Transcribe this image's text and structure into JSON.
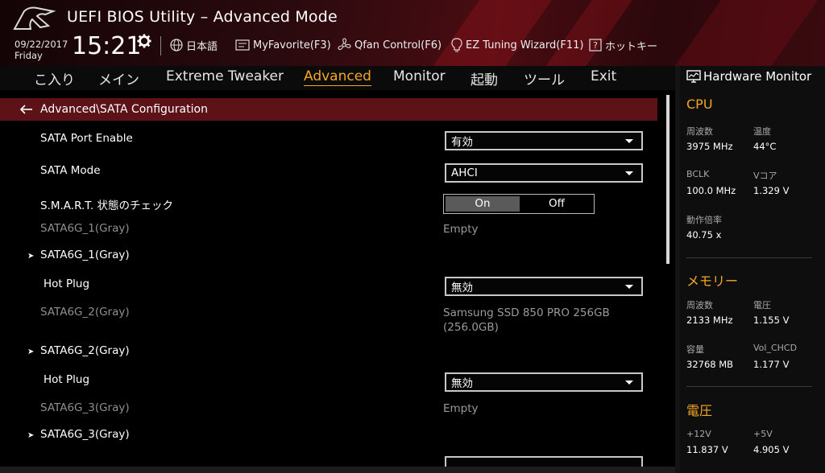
{
  "app": {
    "title": "UEFI BIOS Utility – Advanced Mode"
  },
  "clock": {
    "date": "09/22/2017",
    "day": "Friday",
    "time": "15:21"
  },
  "header_buttons": {
    "language": "日本語",
    "myfavorite": "MyFavorite(F3)",
    "qfan": "Qfan Control(F6)",
    "ez_tuning": "EZ Tuning Wizard(F11)",
    "hotkeys": "ホットキー"
  },
  "nav": {
    "tabs": [
      "こ入り",
      "メイン",
      "Extreme Tweaker",
      "Advanced",
      "Monitor",
      "起動",
      "ツール",
      "Exit"
    ],
    "active": "Advanced"
  },
  "breadcrumb": "Advanced\\SATA Configuration",
  "settings": {
    "sata_port_enable": {
      "label": "SATA Port Enable",
      "value": "有効"
    },
    "sata_mode": {
      "label": "SATA Mode",
      "value": "AHCI"
    },
    "smart": {
      "label": "S.M.A.R.T. 状態のチェック",
      "on": "On",
      "off": "Off",
      "selected": "On"
    },
    "port1_info": {
      "label": "SATA6G_1(Gray)",
      "value": "Empty"
    },
    "port1_sub": {
      "label": "SATA6G_1(Gray)"
    },
    "hotplug1": {
      "label": "Hot Plug",
      "value": "無効"
    },
    "port2_info": {
      "label": "SATA6G_2(Gray)",
      "value_line1": "Samsung SSD 850 PRO 256GB",
      "value_line2": "(256.0GB)"
    },
    "port2_sub": {
      "label": "SATA6G_2(Gray)"
    },
    "hotplug2": {
      "label": "Hot Plug",
      "value": "無効"
    },
    "port3_info": {
      "label": "SATA6G_3(Gray)",
      "value": "Empty"
    },
    "port3_sub": {
      "label": "SATA6G_3(Gray)"
    }
  },
  "hardware_monitor": {
    "title": "Hardware Monitor",
    "cpu": {
      "heading": "CPU",
      "freq_label": "周波数",
      "freq": "3975 MHz",
      "temp_label": "温度",
      "temp": "44°C",
      "bclk_label": "BCLK",
      "bclk": "100.0 MHz",
      "vcore_label": "Vコア",
      "vcore": "1.329 V",
      "ratio_label": "動作倍率",
      "ratio": "40.75 x"
    },
    "memory": {
      "heading": "メモリー",
      "freq_label": "周波数",
      "freq": "2133 MHz",
      "volt_label": "電圧",
      "volt": "1.155 V",
      "cap_label": "容量",
      "cap": "32768 MB",
      "chcd_label": "Vol_CHCD",
      "chcd": "1.177 V"
    },
    "voltage": {
      "heading": "電圧",
      "v12_label": "+12V",
      "v12": "11.837 V",
      "v5_label": "+5V",
      "v5": "4.905 V"
    }
  }
}
